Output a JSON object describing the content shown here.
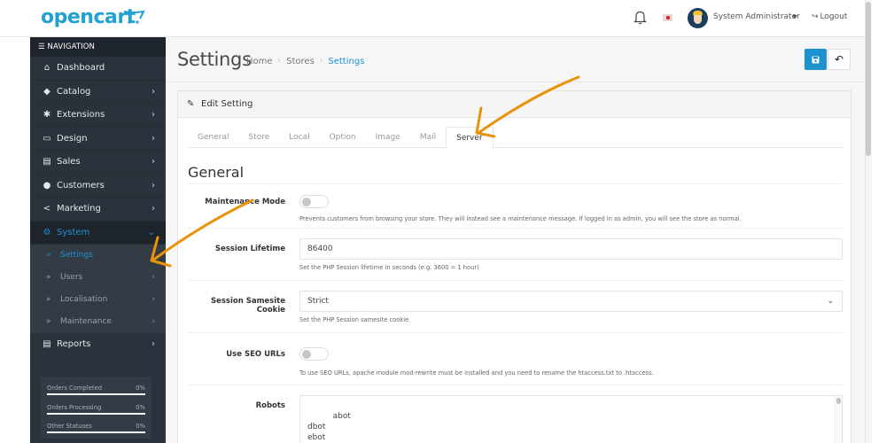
{
  "header": {
    "logo_text": "opencart",
    "user_name": "System Administrator",
    "logout_label": "Logout"
  },
  "sidebar": {
    "heading": "NAVIGATION",
    "items": [
      {
        "label": "Dashboard",
        "icon": "home-icon",
        "has_children": false
      },
      {
        "label": "Catalog",
        "icon": "tag-icon",
        "has_children": true
      },
      {
        "label": "Extensions",
        "icon": "puzzle-icon",
        "has_children": true
      },
      {
        "label": "Design",
        "icon": "monitor-icon",
        "has_children": true
      },
      {
        "label": "Sales",
        "icon": "cart-icon",
        "has_children": true
      },
      {
        "label": "Customers",
        "icon": "user-icon",
        "has_children": true
      },
      {
        "label": "Marketing",
        "icon": "share-icon",
        "has_children": true
      },
      {
        "label": "System",
        "icon": "gear-icon",
        "has_children": true,
        "active": true,
        "expanded": true
      }
    ],
    "system_children": [
      {
        "label": "Settings",
        "active": true
      },
      {
        "label": "Users"
      },
      {
        "label": "Localisation"
      },
      {
        "label": "Maintenance"
      }
    ],
    "reports_label": "Reports",
    "stats": [
      {
        "label": "Orders Completed",
        "percent_text": "0%",
        "percent": 0
      },
      {
        "label": "Orders Processing",
        "percent_text": "0%",
        "percent": 0
      },
      {
        "label": "Other Statuses",
        "percent_text": "0%",
        "percent": 0
      }
    ]
  },
  "main": {
    "title": "Settings",
    "breadcrumb": [
      "Home",
      "Stores",
      "Settings"
    ],
    "card_title": "Edit Setting",
    "tabs": [
      "General",
      "Store",
      "Local",
      "Option",
      "Image",
      "Mail",
      "Server"
    ],
    "active_tab": "Server",
    "section_title": "General",
    "fields": {
      "maintenance_mode": {
        "label": "Maintenance Mode",
        "enabled": false,
        "help": "Prevents customers from browsing your store. They will instead see a maintenance message. If logged in as admin, you will see the store as normal."
      },
      "session_lifetime": {
        "label": "Session Lifetime",
        "value": "86400",
        "help": "Set the PHP Session lifetime in seconds (e.g. 3600 = 1 hour)"
      },
      "session_samesite": {
        "label": "Session Samesite Cookie",
        "value": "Strict",
        "help": "Set the PHP Session samesite cookie"
      },
      "seo_urls": {
        "label": "Use SEO URLs",
        "enabled": false,
        "help": "To use SEO URLs, apache module mod-rewrite must be installed and you need to rename the htaccess.txt to .htaccess."
      },
      "robots": {
        "label": "Robots",
        "value": "abot\ndbot\nebot\nhbot"
      }
    }
  },
  "colors": {
    "brand": "#23a1d1",
    "accent": "#1e91cf",
    "sidebar_bg": "#2a323b",
    "annotation_arrow": "#e8930c"
  }
}
